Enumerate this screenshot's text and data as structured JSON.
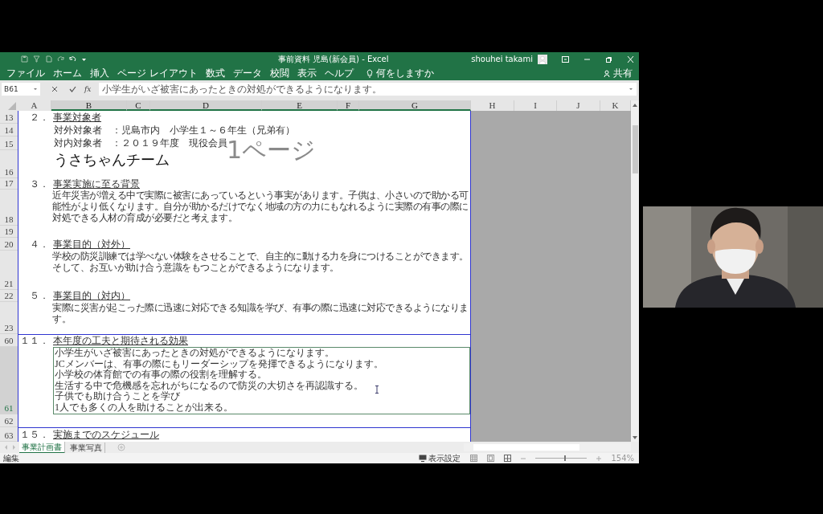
{
  "window": {
    "title": "事前資料 児島(新会員) - Excel",
    "user": "shouhei takami"
  },
  "ribbon_tabs": [
    {
      "label": "ファイル"
    },
    {
      "label": "ホーム"
    },
    {
      "label": "挿入"
    },
    {
      "label": "ページ レイアウト"
    },
    {
      "label": "数式"
    },
    {
      "label": "データ"
    },
    {
      "label": "校閲"
    },
    {
      "label": "表示"
    },
    {
      "label": "ヘルプ"
    }
  ],
  "tell_me": "何をしますか",
  "share": "共有",
  "formula_bar": {
    "name_box": "B61",
    "function_label": "fx",
    "formula": "小学生がいざ被害にあったときの対処ができるようになります。"
  },
  "columns": [
    {
      "label": "A",
      "selected": false
    },
    {
      "label": "B",
      "selected": true
    },
    {
      "label": "C",
      "selected": true
    },
    {
      "label": "D",
      "selected": true
    },
    {
      "label": "E",
      "selected": true
    },
    {
      "label": "F",
      "selected": true
    },
    {
      "label": "G",
      "selected": true
    },
    {
      "label": "H",
      "selected": false
    },
    {
      "label": "I",
      "selected": false
    },
    {
      "label": "J",
      "selected": false
    },
    {
      "label": "K",
      "selected": false
    }
  ],
  "rows": [
    {
      "number": "13",
      "selected": false,
      "page_break": false,
      "kind": "heading",
      "index": "２．",
      "text": "事業対象者"
    },
    {
      "number": "14",
      "selected": false,
      "page_break": false,
      "kind": "text",
      "text": "対外対象者　：児島市内　小学生１～６年生（兄弟有）"
    },
    {
      "number": "15",
      "selected": false,
      "page_break": false,
      "kind": "text",
      "text": "対内対象者　：２０１９年度　現役会員"
    },
    {
      "number": "16",
      "selected": false,
      "page_break": false,
      "kind": "title",
      "text": "うさちゃんチーム"
    },
    {
      "number": "17",
      "selected": false,
      "page_break": false,
      "kind": "heading",
      "index": "３．",
      "text": "事業実施に至る背景"
    },
    {
      "number": "18",
      "selected": false,
      "page_break": false,
      "kind": "paragraph",
      "text": "近年災害が増える中で実際に被害にあっているという事実があります。子供は、小さいので助かる可能性がより低くなります。自分が助かるだけでなく地域の方の力にもなれるように実際の有事の際に対処できる人材の育成が必要だと考えます。"
    },
    {
      "number": "19",
      "selected": false,
      "page_break": false,
      "kind": "empty"
    },
    {
      "number": "20",
      "selected": false,
      "page_break": false,
      "kind": "heading",
      "index": "４．",
      "text": "事業目的（対外）"
    },
    {
      "number": "21",
      "selected": false,
      "page_break": false,
      "kind": "paragraph",
      "text": "学校の防災訓練では学べない体験をさせることで、自主的に動ける力を身につけることができます。そして、お互いが助け合う意識をもつことができるようになります。"
    },
    {
      "number": "22",
      "selected": false,
      "page_break": false,
      "kind": "heading",
      "index": "５．",
      "text": "事業目的（対内）"
    },
    {
      "number": "23",
      "selected": false,
      "page_break": false,
      "kind": "paragraph",
      "text": "実際に災害が起こった際に迅速に対応できる知識を学び、有事の際に迅速に対応できるようになります。"
    },
    {
      "number": "60",
      "selected": false,
      "page_break": true,
      "kind": "heading",
      "index": "１１．",
      "text": "本年度の工夫と期待される効果"
    },
    {
      "number": "61",
      "selected": true,
      "page_break": false,
      "kind": "list",
      "lines": [
        "小学生がいざ被害にあったときの対処ができるようになります。",
        "JCメンバーは、有事の際にもリーダーシップを発揮できるようになります。",
        "小学校の体育館での有事の際の役割を理解する。",
        "生活する中で危機感を忘れがちになるので防災の大切さを再認識する。",
        "子供でも助け合うことを学び",
        "1人でも多くの人を助けることが出来る。"
      ]
    },
    {
      "number": "62",
      "selected": false,
      "page_break": false,
      "kind": "empty"
    },
    {
      "number": "63",
      "selected": false,
      "page_break": true,
      "kind": "heading",
      "index": "１５．",
      "text": "実施までのスケジュール"
    }
  ],
  "page_label": "1ページ",
  "sheet_tabs": [
    {
      "label": "事業計画書",
      "selected": true
    },
    {
      "label": "事業写真",
      "selected": false
    }
  ],
  "status_bar": {
    "mode": "編集",
    "display_settings": "表示設定",
    "zoom_slider": {
      "level": 0.55
    },
    "zoom": "154%"
  }
}
